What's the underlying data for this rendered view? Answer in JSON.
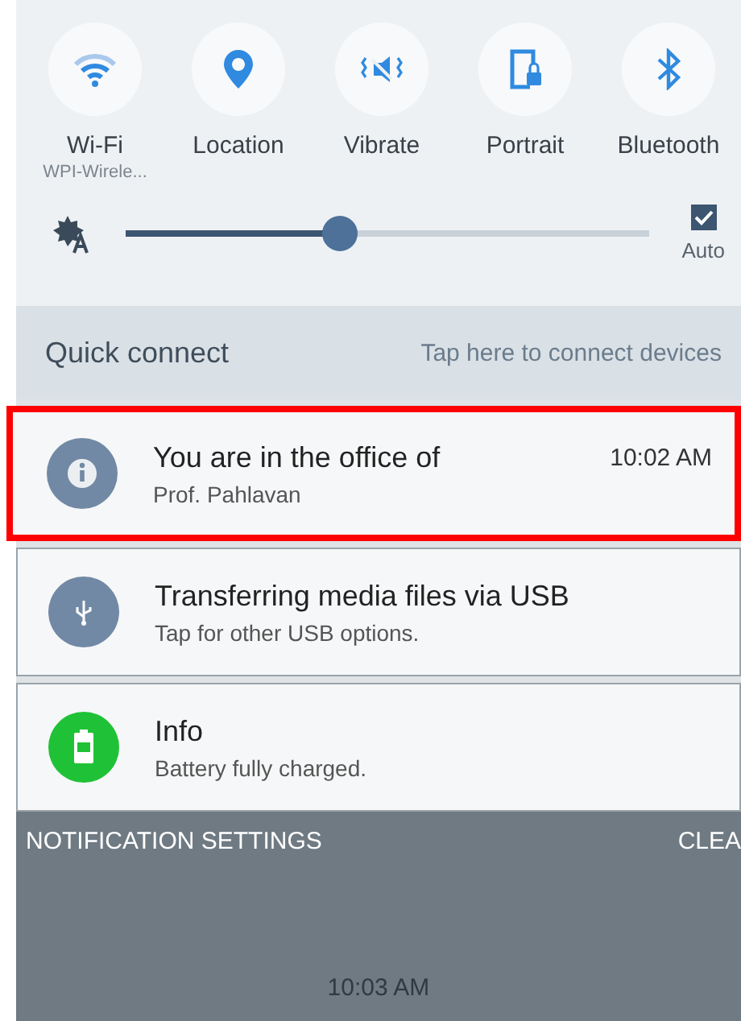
{
  "quick_settings": [
    {
      "kind": "wifi",
      "label": "Wi-Fi",
      "sublabel": "WPI-Wirele..."
    },
    {
      "kind": "location",
      "label": "Location"
    },
    {
      "kind": "vibrate",
      "label": "Vibrate"
    },
    {
      "kind": "portrait",
      "label": "Portrait"
    },
    {
      "kind": "bluetooth",
      "label": "Bluetooth"
    }
  ],
  "brightness": {
    "level": 0.41,
    "auto": {
      "label": "Auto",
      "checked": true
    }
  },
  "quick_connect": {
    "title": "Quick connect",
    "hint": "Tap here to connect devices"
  },
  "notifications": [
    {
      "kind": "info",
      "title": "You are in the office of",
      "text": "Prof. Pahlavan",
      "time": "10:02 AM",
      "highlighted": true
    },
    {
      "kind": "usb",
      "title": "Transferring media files via USB",
      "text": "Tap for other USB options.",
      "highlighted": false
    },
    {
      "kind": "battery",
      "title": "Info",
      "text": "Battery fully charged.",
      "highlighted": false
    }
  ],
  "footer": {
    "settings": "NOTIFICATION SETTINGS",
    "clear": "CLEA"
  },
  "clock": "10:03 AM"
}
